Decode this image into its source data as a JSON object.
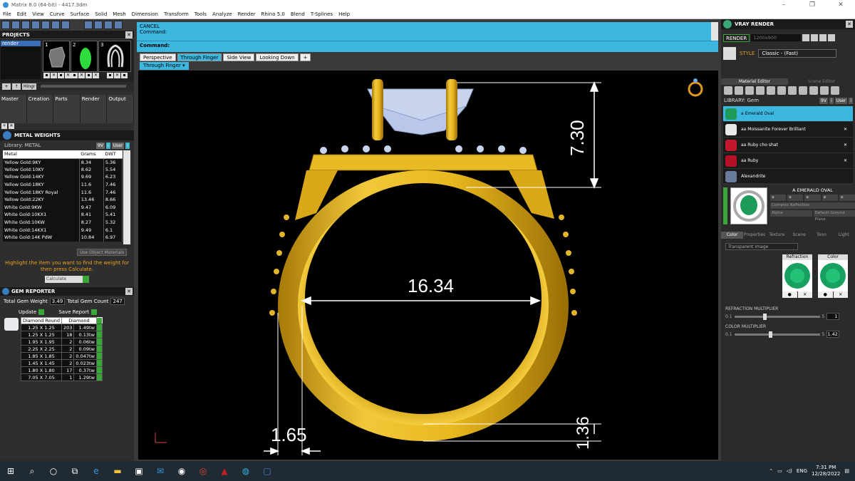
{
  "window": {
    "title": "Matrix 8.0 (64-bit) - 4417.3dm"
  },
  "menu": [
    "File",
    "Edit",
    "View",
    "Curve",
    "Surface",
    "Solid",
    "Mesh",
    "Dimension",
    "Transform",
    "Tools",
    "Analyze",
    "Render",
    "Rhino 5.0",
    "Blend",
    "T-Splines",
    "Help"
  ],
  "projects": {
    "title": "PROJECTS",
    "selected": "render",
    "thumbs": [
      "1",
      "2",
      "3"
    ],
    "toolbar": [
      "+",
      "↑",
      "Hingr"
    ],
    "tabs": [
      "Master",
      "Creation",
      "Parts",
      "Render",
      "Output"
    ]
  },
  "metal_weights": {
    "title": "METAL WEIGHTS",
    "library": "Library: METAL",
    "columns": [
      "Metal",
      "Grams",
      "DWT"
    ],
    "rows": [
      [
        "Yellow Gold:9KY",
        "8.34",
        "5.36"
      ],
      [
        "Yellow Gold:10KY",
        "8.62",
        "5.54"
      ],
      [
        "Yellow Gold:14KY",
        "9.69",
        "6.23"
      ],
      [
        "Yellow Gold:18KY",
        "11.6",
        "7.46"
      ],
      [
        "Yellow Gold:18KY Royal",
        "11.6",
        "7.46"
      ],
      [
        "Yellow Gold:22KY",
        "13.46",
        "8.66"
      ],
      [
        "White Gold:9KW",
        "9.47",
        "6.09"
      ],
      [
        "White Gold:10KX1",
        "8.41",
        "5.41"
      ],
      [
        "White Gold:10KW",
        "8.27",
        "5.32"
      ],
      [
        "White Gold:14KX1",
        "9.49",
        "6.1"
      ],
      [
        "White Gold:14K PdW",
        "10.84",
        "6.97"
      ]
    ],
    "use_object_materials": "Use Object Materials",
    "hint": "Highlight the item you want to find the weight for then press Calculate.",
    "calculate": "Calculate"
  },
  "gem_reporter": {
    "title": "GEM REPORTER",
    "total_weight_label": "Total Gem Weight",
    "total_weight": "3.49",
    "total_count_label": "Total Gem Count",
    "total_count": "247",
    "update": "Update",
    "save_report": "Save Report",
    "columns": [
      "Diamond Round",
      "Diamond"
    ],
    "rows": [
      [
        "1.25 X 1.25",
        "203",
        "1.49tw"
      ],
      [
        "1.25 X 1.25",
        "18",
        "0.13tw"
      ],
      [
        "1.95 X 1.95",
        "2",
        "0.06tw"
      ],
      [
        "2.25 X 2.25",
        "2",
        "0.09tw"
      ],
      [
        "1.85 X 1.85",
        "2",
        "0.047tw"
      ],
      [
        "1.45 X 1.45",
        "2",
        "0.023tw"
      ],
      [
        "1.80 X 1.80",
        "17",
        "0.37tw"
      ],
      [
        "7.05 X 7.05",
        "1",
        "1.29tw"
      ]
    ]
  },
  "command": {
    "line1": "CANCEL",
    "line2": "Command:",
    "prompt": "Command:"
  },
  "viewport_tabs": [
    "Perspective",
    "Through Finger",
    "Side View",
    "Looking Down",
    "+"
  ],
  "active_view": "Through Finger",
  "dimensions": {
    "top": "7.30",
    "inner": "16.34",
    "shank": "1.65",
    "bottom": "1.36"
  },
  "vray": {
    "title": "VRAY RENDER",
    "render_btn": "RENDER",
    "resolution": "1200x900",
    "style_label": "STYLE",
    "style_value": "Classic - (Fast)",
    "editor_tabs": [
      "Material Editor",
      "Scene Editor"
    ],
    "library": "LIBRARY: Gem",
    "materials": [
      {
        "name": "a Emerald Oval",
        "color": "#1e9a5a"
      },
      {
        "name": "aa Moissanite Forever Brilliant",
        "color": "#e8e8ea"
      },
      {
        "name": "aa Ruby cho shat",
        "color": "#c0182c"
      },
      {
        "name": "aa Ruby",
        "color": "#b51028"
      },
      {
        "name": "Alexandrite",
        "color": "#6a7a9a"
      }
    ],
    "selected_material": "A EMERALD OVAL",
    "props": [
      "Complex Reflection",
      "Alpha",
      "Default Ground Plane"
    ],
    "prop_tabs": [
      "Color",
      "Properties",
      "Texture",
      "Scene",
      "Toon",
      "Light"
    ],
    "transparency": "Transparent Image",
    "refraction_label": "Refraction",
    "color_label": "Color",
    "refraction_multiplier": {
      "label": "REFRACTION MULTIPLIER",
      "min": "0.1",
      "max": "5",
      "value": "1"
    },
    "color_multiplier": {
      "label": "COLOR MULTIPLIER",
      "min": "0.1",
      "max": "5",
      "value": "1.42"
    }
  },
  "taskbar": {
    "lang": "ENG",
    "time": "7:31 PM",
    "date": "12/28/2022"
  },
  "colors": {
    "accent": "#3cb8e0",
    "gold": "#e0b21a",
    "green": "#3aa63a",
    "orange": "#f0a020"
  }
}
